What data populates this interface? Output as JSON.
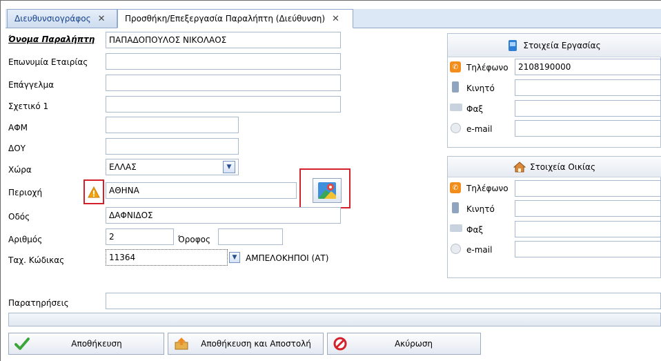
{
  "tabs": [
    {
      "label": "Διευθυνσιογράφος",
      "close": "✕"
    },
    {
      "label": "Προσθήκη/Επεξεργασία Παραλήπτη (Διεύθυνση)",
      "close": "✕"
    }
  ],
  "form": {
    "recipient_name_label": "Όνομα Παραλήπτη",
    "recipient_name_value": "ΠΑΠΑΔΟΠΟΥΛΟΣ ΝΙΚΟΛΑΟΣ",
    "company_label": "Επωνυμία Εταιρίας",
    "profession_label": "Επάγγελμα",
    "related_label": "Σχετικό 1",
    "afm_label": "ΑΦΜ",
    "doy_label": "ΔΟΥ",
    "country_label": "Χώρα",
    "country_value": "ΕΛΛΑΣ",
    "region_label": "Περιοχή",
    "region_value": "ΑΘΗΝΑ",
    "street_label": "Οδός",
    "street_value": "ΔΑΦΝΙΔΟΣ",
    "number_label": "Αριθμός",
    "number_value": "2",
    "floor_label": "Όροφος",
    "zip_label": "Ταχ. Κώδικας",
    "zip_value": "11364",
    "zip_area": "ΑΜΠΕΛΟΚΗΠΟΙ (ΑΤ)",
    "notes_label": "Παρατηρήσεις"
  },
  "work": {
    "title": "Στοιχεία Εργασίας",
    "phone_label": "Τηλέφωνο",
    "phone_value": "2108190000",
    "mobile_label": "Κινητό",
    "fax_label": "Φαξ",
    "email_label": "e-mail"
  },
  "home": {
    "title": "Στοιχεία Οικίας",
    "phone_label": "Τηλέφωνο",
    "mobile_label": "Κινητό",
    "fax_label": "Φαξ",
    "email_label": "e-mail"
  },
  "buttons": {
    "save": "Αποθήκευση",
    "save_send": "Αποθήκευση και Αποστολή",
    "cancel": "Ακύρωση"
  },
  "colors": {
    "accent": "#15428b",
    "highlight_red": "#d3202a",
    "phone_orange": "#f28c1a",
    "warning": "#f5a20a"
  }
}
